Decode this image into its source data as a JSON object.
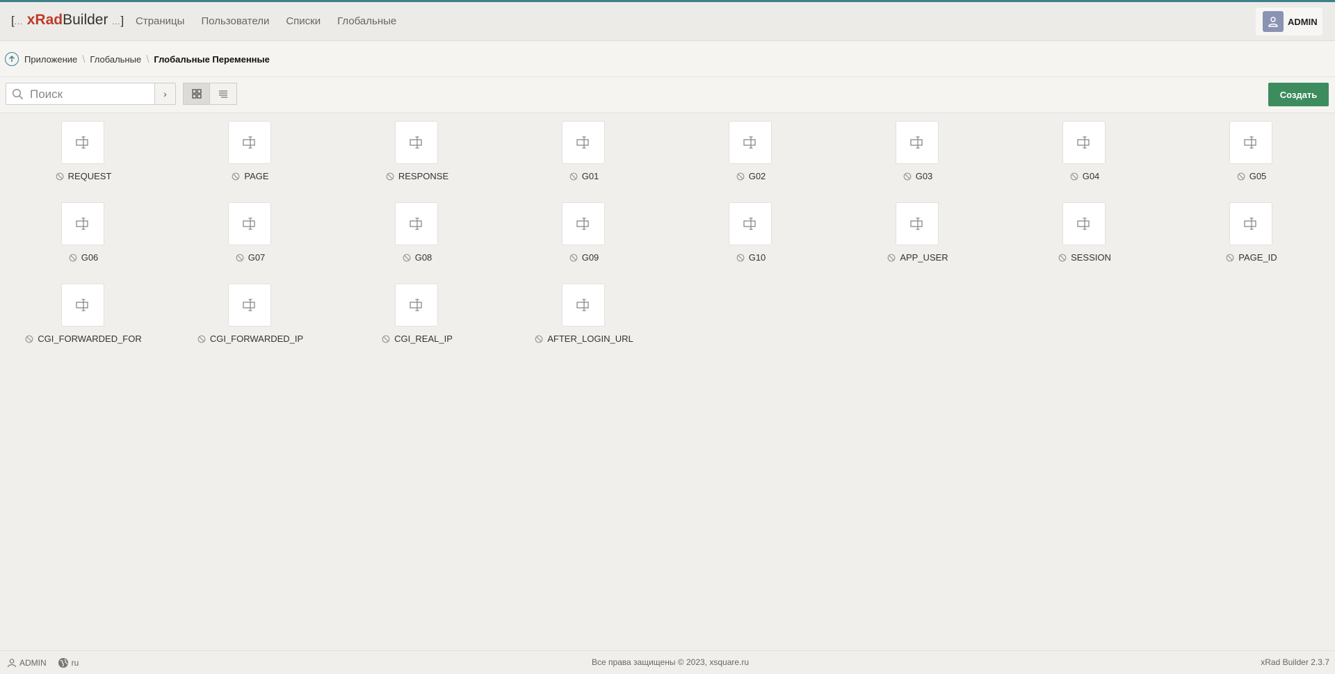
{
  "app": {
    "logo_open": "[",
    "logo_dots_left": "...",
    "logo_x": "xRad",
    "logo_builder": "Builder",
    "logo_dots_right": "...",
    "logo_close": "]"
  },
  "nav": {
    "items": [
      {
        "label": "Страницы"
      },
      {
        "label": "Пользователи"
      },
      {
        "label": "Списки"
      },
      {
        "label": "Глобальные"
      }
    ]
  },
  "user": {
    "name": "ADMIN"
  },
  "breadcrumb": {
    "items": [
      {
        "label": "Приложение"
      },
      {
        "label": "Глобальные"
      }
    ],
    "current": "Глобальные Переменные"
  },
  "toolbar": {
    "search_placeholder": "Поиск",
    "create_label": "Создать"
  },
  "items": [
    {
      "label": "REQUEST"
    },
    {
      "label": "PAGE"
    },
    {
      "label": "RESPONSE"
    },
    {
      "label": "G01"
    },
    {
      "label": "G02"
    },
    {
      "label": "G03"
    },
    {
      "label": "G04"
    },
    {
      "label": "G05"
    },
    {
      "label": "G06"
    },
    {
      "label": "G07"
    },
    {
      "label": "G08"
    },
    {
      "label": "G09"
    },
    {
      "label": "G10"
    },
    {
      "label": "APP_USER"
    },
    {
      "label": "SESSION"
    },
    {
      "label": "PAGE_ID"
    },
    {
      "label": "CGI_FORWARDED_FOR"
    },
    {
      "label": "CGI_FORWARDED_IP"
    },
    {
      "label": "CGI_REAL_IP"
    },
    {
      "label": "AFTER_LOGIN_URL"
    }
  ],
  "footer": {
    "user": "ADMIN",
    "lang": "ru",
    "copyright": "Все права защищены © 2023, xsquare.ru",
    "version": "xRad Builder 2.3.7"
  },
  "colors": {
    "accent": "#3e7f8c",
    "logo_red": "#c0392b",
    "create_button": "#3d8c5e",
    "avatar": "#8a93b3"
  }
}
